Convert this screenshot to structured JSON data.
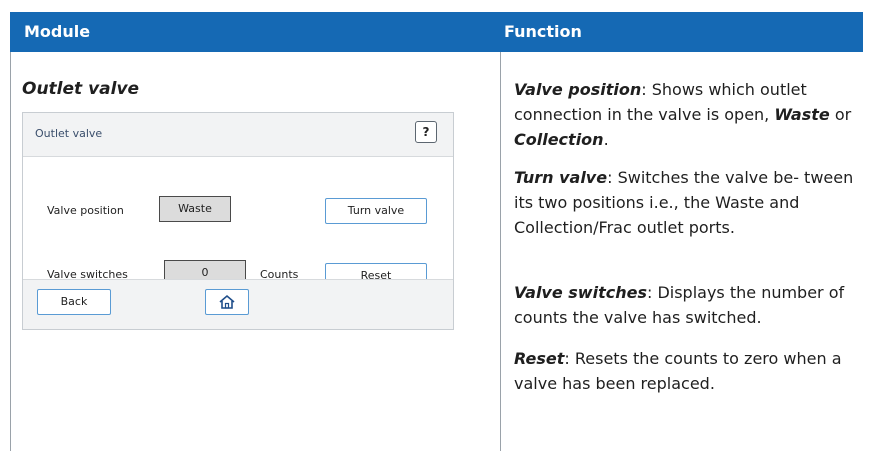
{
  "header": {
    "module_label": "Module",
    "function_label": "Function"
  },
  "module": {
    "title": "Outlet valve"
  },
  "panel": {
    "title": "Outlet valve",
    "help_label": "?",
    "valve_position_label": "Valve position",
    "valve_position_value": "Waste",
    "turn_valve_label": "Turn valve",
    "valve_switches_label": "Valve switches",
    "valve_switches_value": "0",
    "counts_label": "Counts",
    "reset_label": "Reset",
    "back_label": "Back",
    "home_icon": "home-icon"
  },
  "functions": {
    "valve_position": {
      "term": "Valve position",
      "text_a": ": Shows which outlet connection in the valve is open, ",
      "waste": "Waste",
      "or": " or ",
      "collection": "Collection",
      "end": "."
    },
    "turn_valve": {
      "term": "Turn valve",
      "text": ": Switches the valve be- tween its two positions i.e., the Waste and Collection/Frac outlet ports."
    },
    "valve_switches": {
      "term": "Valve switches",
      "text": ": Displays the number of counts the valve has switched."
    },
    "reset": {
      "term": "Reset",
      "text": ": Resets the counts to zero when a valve has been replaced."
    }
  },
  "colors": {
    "header_bg": "#1569b4",
    "button_border": "#5a9bd4",
    "readout_bg": "#dcdcdc"
  }
}
